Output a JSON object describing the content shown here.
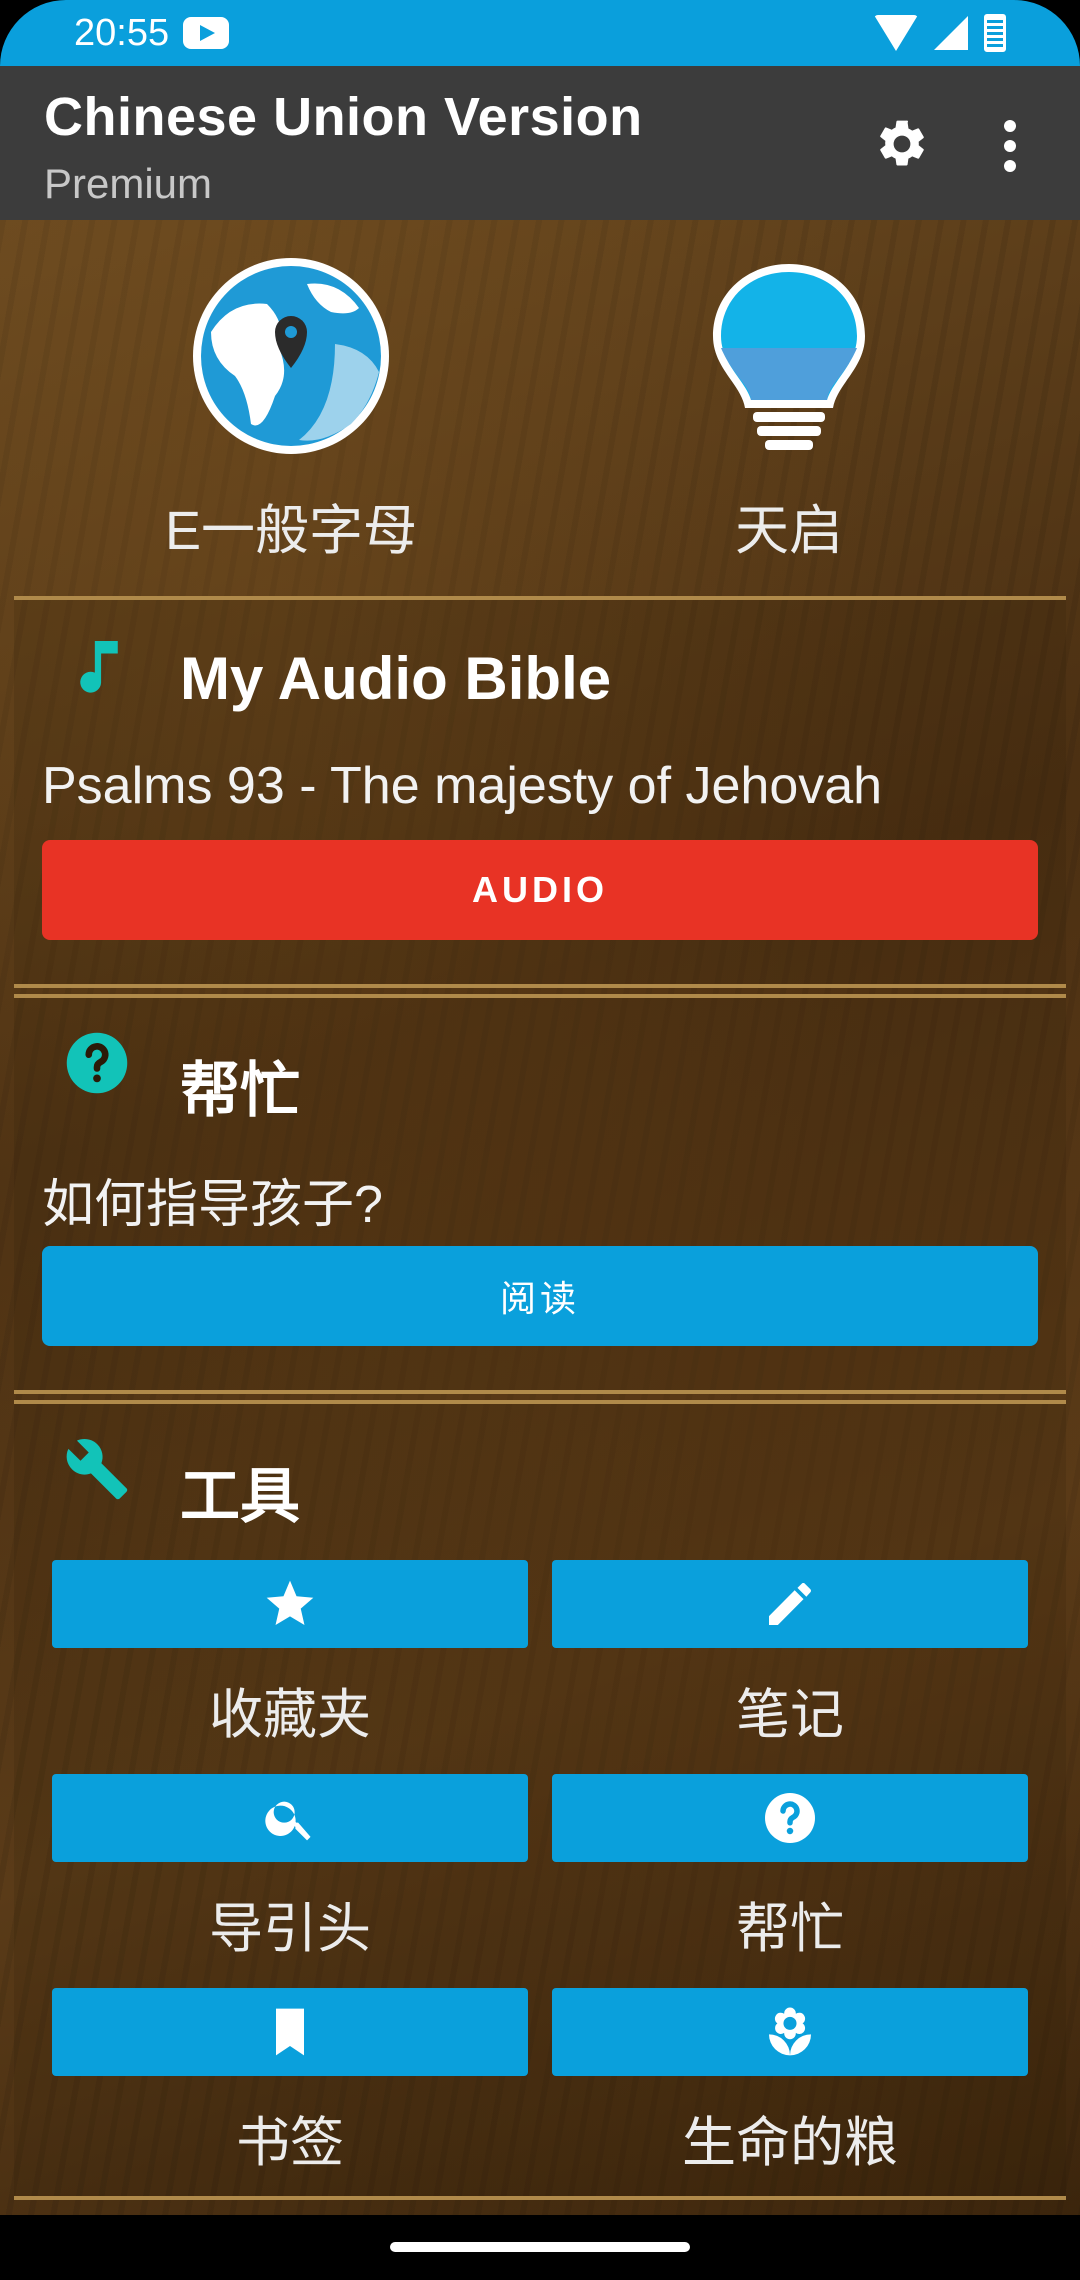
{
  "status_bar": {
    "time": "20:55"
  },
  "app_bar": {
    "title": "Chinese Union Version",
    "subtitle": "Premium"
  },
  "top_items": [
    {
      "label": "E一般字母",
      "icon": "globe-icon"
    },
    {
      "label": "天启",
      "icon": "lightbulb-icon"
    }
  ],
  "audio_section": {
    "title": "My Audio Bible",
    "text": "Psalms 93 - The majesty of Jehovah",
    "button_label": "AUDIO",
    "button_color": "#e83325"
  },
  "help_section": {
    "title": "帮忙",
    "text": "如何指导孩子?",
    "button_label": "阅读",
    "button_color": "#0aa0dc"
  },
  "tools_section": {
    "title": "工具",
    "items": [
      {
        "label": "收藏夹",
        "icon": "star-icon"
      },
      {
        "label": "笔记",
        "icon": "pencil-icon"
      },
      {
        "label": "导引头",
        "icon": "search-icon"
      },
      {
        "label": "帮忙",
        "icon": "help-circle-icon"
      },
      {
        "label": "书签",
        "icon": "bookmark-icon"
      },
      {
        "label": "生命的粮",
        "icon": "flower-icon"
      }
    ]
  },
  "colors": {
    "accent": "#0aa0dc",
    "teal_icon": "#12c3b8",
    "appbar": "#3c3c3c",
    "status_bar": "#0a9fdc"
  }
}
